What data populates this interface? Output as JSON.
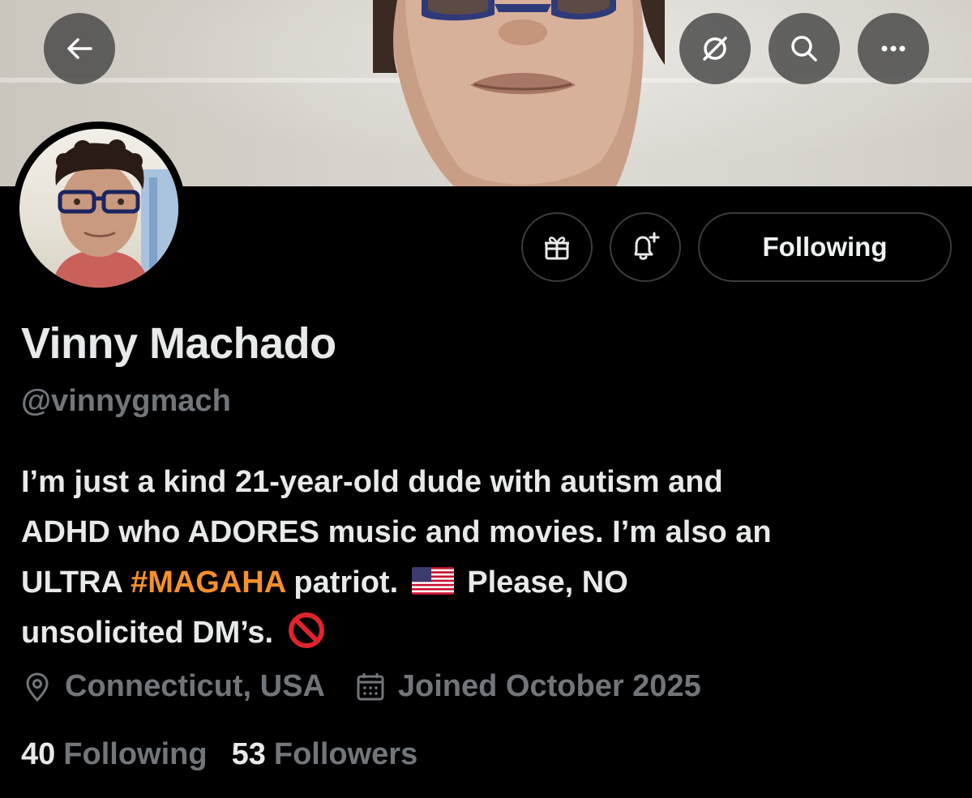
{
  "header": {
    "back_icon": "arrow-left-icon",
    "grok_icon": "grok-icon",
    "search_icon": "search-icon",
    "more_icon": "more-horizontal-icon"
  },
  "actions": {
    "gift_icon": "gift-icon",
    "notify_icon": "bell-plus-icon",
    "following_label": "Following"
  },
  "profile": {
    "display_name": "Vinny Machado",
    "handle": "@vinnygmach",
    "bio": {
      "line1": "I’m just a kind 21-year-old dude with autism and",
      "line2": "ADHD who ADORES music and movies. I’m also an",
      "line3_prefix": "ULTRA ",
      "hashtag": "#MAGAHA",
      "line3_mid": " patriot.",
      "line3_suffix": " Please, NO",
      "line4": "unsolicited DM’s."
    },
    "location": "Connecticut, USA",
    "joined": "Joined October 2025"
  },
  "stats": {
    "following_count": "40",
    "following_label": "Following",
    "followers_count": "53",
    "followers_label": "Followers"
  },
  "colors": {
    "background": "#000000",
    "text_primary": "#e7e9ea",
    "text_secondary": "#71767b",
    "hashtag": "#f7902b",
    "border": "#3a3d40"
  }
}
